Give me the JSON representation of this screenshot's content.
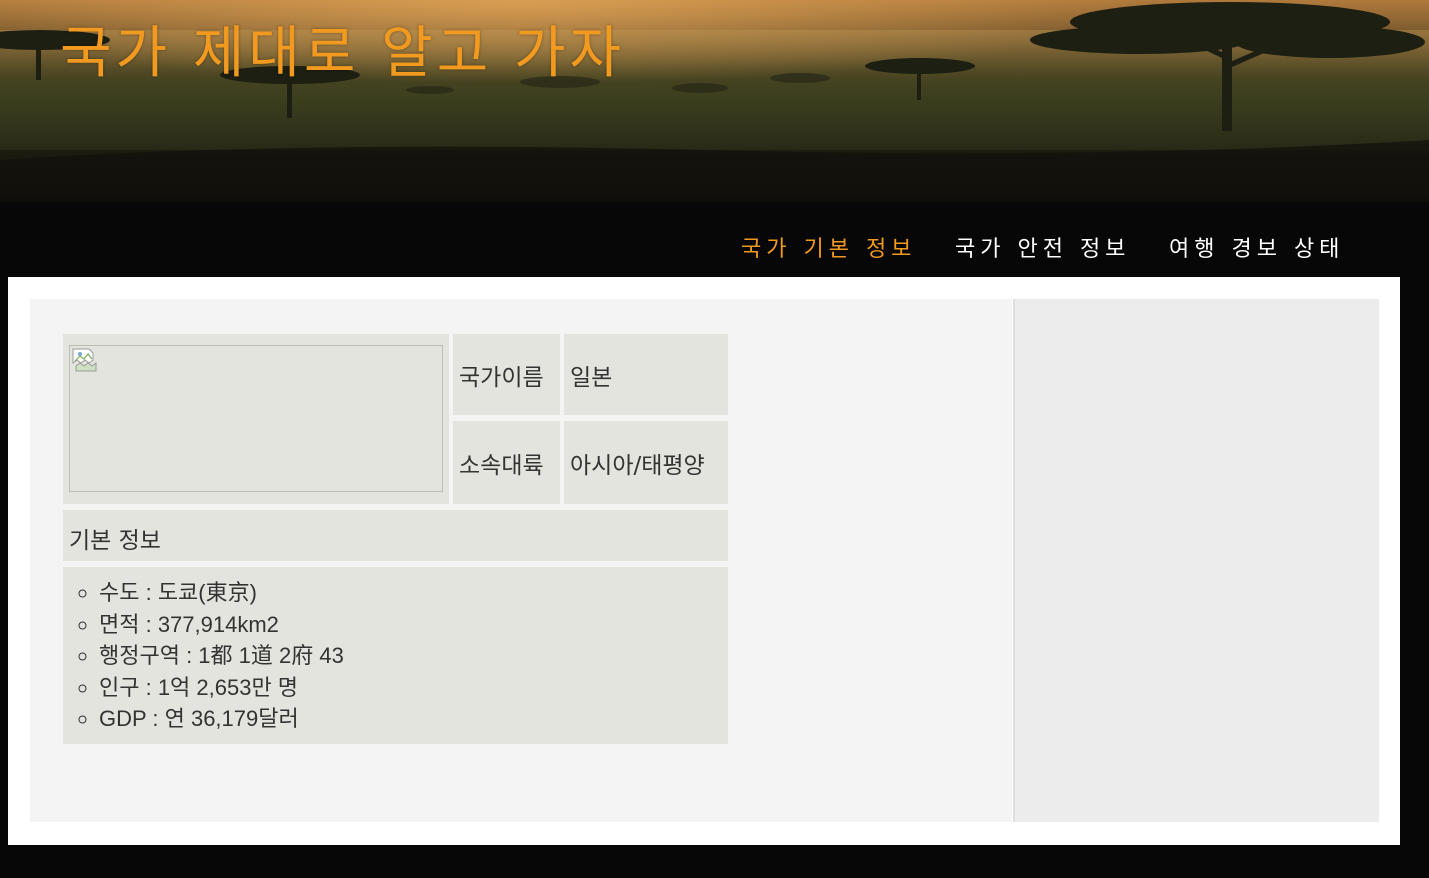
{
  "header": {
    "site_title": "국가 제대로 알고 가자"
  },
  "nav": {
    "items": [
      {
        "label": "국가 기본 정보",
        "active": true
      },
      {
        "label": "국가 안전 정보",
        "active": false
      },
      {
        "label": "여행 경보 상태",
        "active": false
      }
    ]
  },
  "country": {
    "name_label": "국가이름",
    "name_value": "일본",
    "continent_label": "소속대륙",
    "continent_value": "아시아/태평양",
    "section_title": "기본 정보",
    "facts": [
      "수도 : 도쿄(東京)",
      "면적 : 377,914km2",
      "행정구역 : 1都 1道 2府 43",
      "인구 : 1억 2,653만 명",
      "GDP : 연 36,179달러"
    ]
  },
  "colors": {
    "accent": "#f29a1f",
    "nav_bg": "#070707",
    "cell_bg": "#e4e4de",
    "content_bg": "#f4f4f4",
    "sidebar_bg": "#ececec"
  },
  "icons": {
    "flag_image": "broken-image-icon"
  }
}
